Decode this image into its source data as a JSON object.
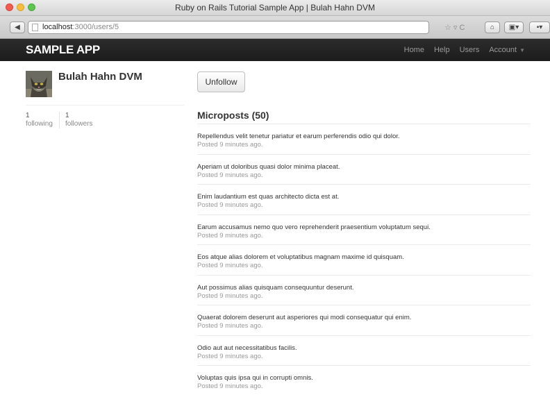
{
  "window": {
    "title": "Ruby on Rails Tutorial Sample App | Bulah Hahn DVM"
  },
  "browser": {
    "url_host": "localhost",
    "url_path": ":3000/users/5",
    "back_glyph": "◀",
    "url_icons": "☆ ▿ C",
    "home_glyph": "⌂",
    "bookmark_glyph": "▣▾",
    "extra_glyph": "▪▾"
  },
  "nav": {
    "brand": "SAMPLE APP",
    "links": [
      "Home",
      "Help",
      "Users",
      "Account"
    ]
  },
  "profile": {
    "name": "Bulah Hahn DVM",
    "following_count": "1",
    "following_label": "following",
    "followers_count": "1",
    "followers_label": "followers"
  },
  "actions": {
    "unfollow": "Unfollow"
  },
  "microposts": {
    "title": "Microposts (50)",
    "items": [
      {
        "content": "Repellendus velit tenetur pariatur et earum perferendis odio qui dolor.",
        "ts": "Posted 9 minutes ago."
      },
      {
        "content": "Aperiam ut doloribus quasi dolor minima placeat.",
        "ts": "Posted 9 minutes ago."
      },
      {
        "content": "Enim laudantium est quas architecto dicta est at.",
        "ts": "Posted 9 minutes ago."
      },
      {
        "content": "Earum accusamus nemo quo vero reprehenderit praesentium voluptatum sequi.",
        "ts": "Posted 9 minutes ago."
      },
      {
        "content": "Eos atque alias dolorem et voluptatibus magnam maxime id quisquam.",
        "ts": "Posted 9 minutes ago."
      },
      {
        "content": "Aut possimus alias quisquam consequuntur deserunt.",
        "ts": "Posted 9 minutes ago."
      },
      {
        "content": "Quaerat dolorem deserunt aut asperiores qui modi consequatur qui enim.",
        "ts": "Posted 9 minutes ago."
      },
      {
        "content": "Odio aut aut necessitatibus facilis.",
        "ts": "Posted 9 minutes ago."
      },
      {
        "content": "Voluptas quis ipsa qui in corrupti omnis.",
        "ts": "Posted 9 minutes ago."
      }
    ]
  }
}
